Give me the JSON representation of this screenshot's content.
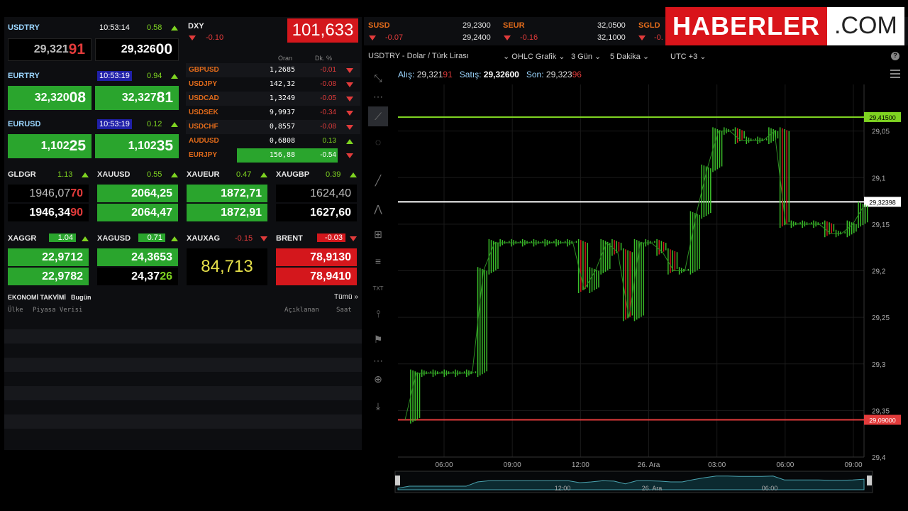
{
  "quotes": {
    "usdtry": {
      "sym": "USDTRY",
      "time": "10:53:14",
      "pct": "0.58",
      "bid_main": "29,321",
      "bid_hl": "91",
      "ask_main": "29,326",
      "ask_hl": "00"
    },
    "eurtry": {
      "sym": "EURTRY",
      "time": "10:53:19",
      "pct": "0.94",
      "bid_main": "32,320",
      "bid_hl": "08",
      "ask_main": "32,327",
      "ask_hl": "81"
    },
    "eurusd": {
      "sym": "EURUSD",
      "time": "10:53:19",
      "pct": "0.12",
      "bid_main": "1,102",
      "bid_hl": "25",
      "ask_main": "1,102",
      "ask_hl": "35"
    }
  },
  "dxy": {
    "sym": "DXY",
    "chg": "-0.10",
    "value": "101,633"
  },
  "fx_table": {
    "col_rate": "Oran",
    "col_change": "Dk. %",
    "rows": [
      {
        "sym": "GBPUSD",
        "val": "1,2685",
        "chg": "-0.01",
        "dir": "down"
      },
      {
        "sym": "USDJPY",
        "val": "142,32",
        "chg": "-0.08",
        "dir": "down"
      },
      {
        "sym": "USDCAD",
        "val": "1,3249",
        "chg": "-0.05",
        "dir": "down"
      },
      {
        "sym": "USDSEK",
        "val": "9,9937",
        "chg": "-0.34",
        "dir": "down"
      },
      {
        "sym": "USDCHF",
        "val": "0,8557",
        "chg": "-0.08",
        "dir": "down"
      },
      {
        "sym": "AUDUSD",
        "val": "0,6808",
        "chg": "0.13",
        "dir": "up"
      },
      {
        "sym": "EURJPY",
        "val": "156,88",
        "chg": "-0.54",
        "dir": "down"
      }
    ]
  },
  "metals": {
    "gldgr": {
      "sym": "GLDGR",
      "pct": "1.13",
      "bid_main": "1946,07",
      "bid_hl": "70",
      "ask_main": "1946,34",
      "ask_hl": "90"
    },
    "xauusd": {
      "sym": "XAUUSD",
      "pct": "0.55",
      "bid": "2064,25",
      "ask": "2064,47"
    },
    "xaueur": {
      "sym": "XAUEUR",
      "pct": "0.47",
      "bid": "1872,71",
      "ask": "1872,91"
    },
    "xaugbp": {
      "sym": "XAUGBP",
      "pct": "0.39",
      "bid": "1624,40",
      "ask": "1627,60"
    },
    "xaggr": {
      "sym": "XAGGR",
      "pct": "1.04",
      "bid": "22,9712",
      "ask": "22,9782"
    },
    "xagusd": {
      "sym": "XAGUSD",
      "pct": "0.71",
      "bid": "24,3653",
      "ask_main": "24,37",
      "ask_hl": "26"
    },
    "xauxag": {
      "sym": "XAUXAG",
      "pct": "-0.15",
      "value": "84,713"
    },
    "brent": {
      "sym": "BRENT",
      "pct": "-0.03",
      "bid": "78,9130",
      "ask": "78,9410"
    }
  },
  "economy": {
    "title": "EKONOMİ TAKVİMİ",
    "today": "Bugün",
    "all": "Tümü »",
    "col_country": "Ülke",
    "col_data": "Piyasa Verisi",
    "col_announced": "Açıklanan",
    "col_time": "Saat"
  },
  "top_right": {
    "susd": {
      "sym": "SUSD",
      "chg": "-0.07",
      "v1": "29,2300",
      "v2": "29,2400"
    },
    "seur": {
      "sym": "SEUR",
      "chg": "-0.16",
      "v1": "32,0500",
      "v2": "32,1000"
    },
    "sgld": {
      "sym": "SGLD",
      "chg": "-0."
    }
  },
  "logo": {
    "red": "HABERLER",
    "white": ".COM"
  },
  "chart": {
    "title": "USDTRY - Dolar / Türk Lirası",
    "style": "OHLC Grafik",
    "range": "3 Gün",
    "interval": "5 Dakika",
    "tz": "UTC +3",
    "bid_label": "Alış:",
    "bid_main": "29,321",
    "bid_hl": "91",
    "ask_label": "Satış:",
    "ask": "29,32600",
    "last_label": "Son:",
    "last_main": "29,323",
    "last_hl": "96",
    "help": "?",
    "y_ticks": [
      "29,4",
      "29,35",
      "29,3",
      "29,25",
      "29,2",
      "29,15",
      "29,1",
      "29,05"
    ],
    "x_ticks": [
      "06:00",
      "09:00",
      "12:00",
      "26. Ara",
      "03:00",
      "06:00",
      "09:00"
    ],
    "nav_ticks": [
      "12:00",
      "26. Ara",
      "06:00"
    ],
    "high_label": "29,41500",
    "current_label": "29,32398",
    "low_label": "29,09000"
  },
  "chart_data": {
    "type": "line",
    "title": "USDTRY - Dolar / Türk Lirası",
    "ylim": [
      29.05,
      29.45
    ],
    "y_ticks": [
      29.05,
      29.1,
      29.15,
      29.2,
      29.25,
      29.3,
      29.35,
      29.4
    ],
    "x_ticks": [
      "06:00",
      "09:00",
      "12:00",
      "26. Ara",
      "03:00",
      "06:00",
      "09:00"
    ],
    "reference_lines": [
      {
        "value": 29.415,
        "color": "#7ed321"
      },
      {
        "value": 29.32398,
        "color": "#ffffff"
      },
      {
        "value": 29.09,
        "color": "#e23b3b"
      }
    ],
    "series": [
      {
        "values": [
          29.09,
          29.14,
          29.14,
          29.14,
          29.14,
          29.14,
          29.14,
          29.25,
          29.28,
          29.28,
          29.28,
          29.28,
          29.28,
          29.28,
          29.28,
          29.28,
          29.23,
          29.25,
          29.28,
          29.27,
          29.2,
          29.28,
          29.28,
          29.27,
          29.25,
          29.25,
          29.31,
          29.36,
          29.4,
          29.4,
          29.39,
          29.39,
          29.39,
          29.4,
          29.3,
          29.3,
          29.3,
          29.3,
          29.29,
          29.29,
          29.3,
          29.32
        ]
      }
    ]
  }
}
